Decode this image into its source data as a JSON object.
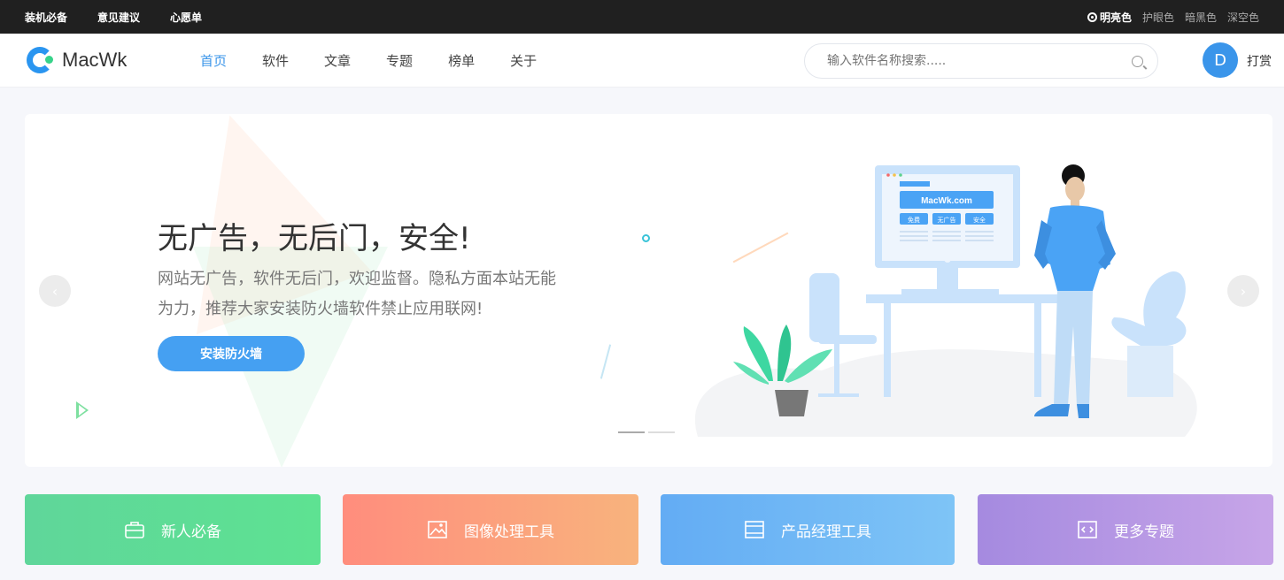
{
  "topbar": {
    "links": [
      "装机必备",
      "意见建议",
      "心愿单"
    ],
    "themes": {
      "active": "明亮色",
      "others": [
        "护眼色",
        "暗黑色",
        "深空色"
      ]
    }
  },
  "header": {
    "logo_text": "MacWk",
    "nav": [
      "首页",
      "软件",
      "文章",
      "专题",
      "榜单",
      "关于"
    ],
    "active_nav": "首页",
    "search_placeholder": "输入软件名称搜索.....",
    "avatar_letter": "D",
    "donate_label": "打赏"
  },
  "banner": {
    "title": "无广告，无后门，安全!",
    "description": "网站无广告，软件无后门，欢迎监督。隐私方面本站无能为力，推荐大家安装防火墙软件禁止应用联网!",
    "cta_label": "安装防火墙",
    "prev_icon": "chevron-left-icon",
    "next_icon": "chevron-right-icon",
    "slide_indicator": {
      "count": 2,
      "active": 1
    },
    "illustration": {
      "screen_title": "MacWk.com",
      "screen_tags": [
        "免费",
        "无广告",
        "安全"
      ]
    }
  },
  "categories": [
    {
      "label": "新人必备",
      "icon": "briefcase-icon"
    },
    {
      "label": "图像处理工具",
      "icon": "image-icon"
    },
    {
      "label": "产品经理工具",
      "icon": "layout-icon"
    },
    {
      "label": "更多专题",
      "icon": "code-icon"
    }
  ],
  "colors": {
    "accent": "#3a95ea",
    "topbar": "#202020",
    "card_green": "#5fd69a",
    "card_orange": "#ff8d7d",
    "card_blue": "#63acf4",
    "card_purple": "#a58ae0"
  }
}
